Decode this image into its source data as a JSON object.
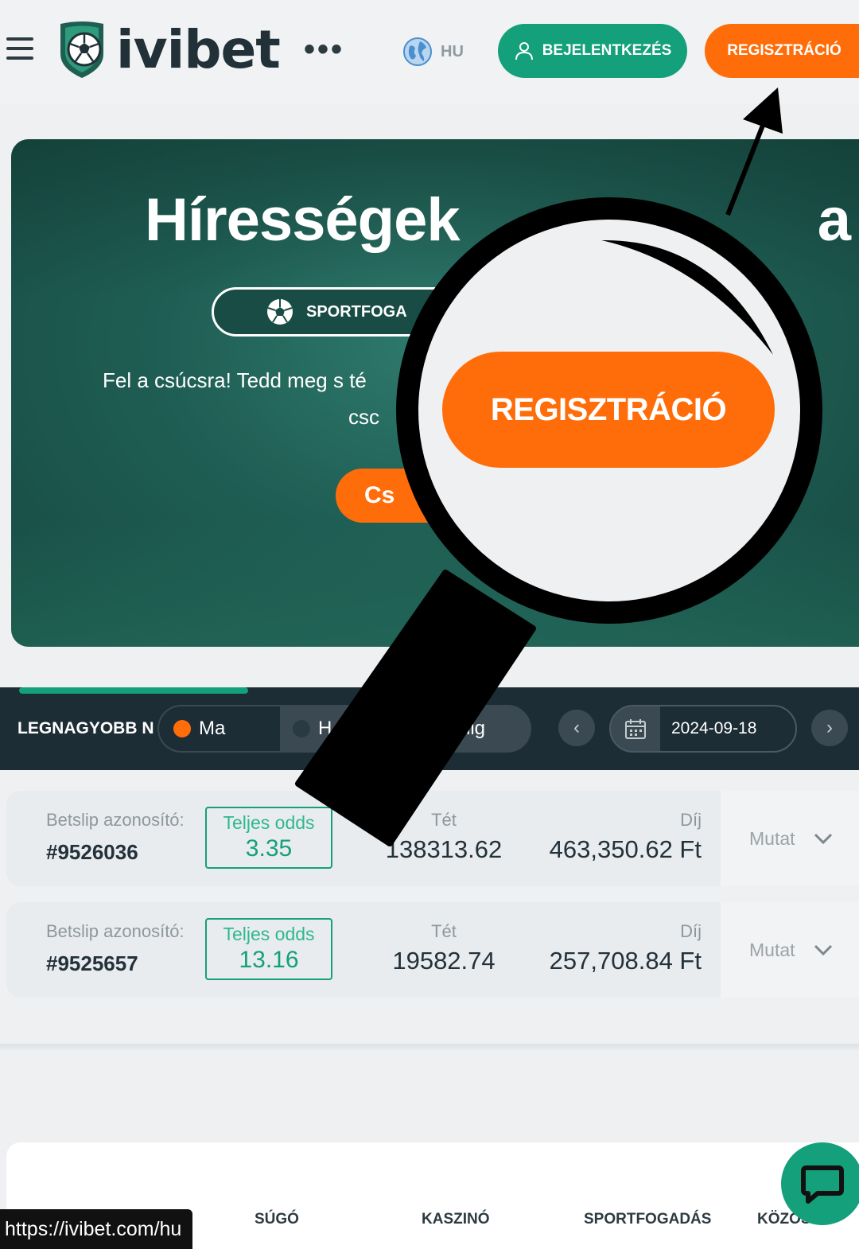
{
  "header": {
    "logo_text": "ivibet",
    "more_label": "•••",
    "language": "HU",
    "login_label": "BEJELENTKEZÉS",
    "register_label": "REGISZTRÁCIÓ"
  },
  "banner": {
    "title": "Hírességek",
    "title_right": "a",
    "pill_label": "SPORTFOGA",
    "description_line1": "Fel a csúcsra! Tedd meg s té",
    "description_line2": "csc",
    "cta_label": "Cs"
  },
  "magnifier": {
    "zoom_label": "REGISZTRÁCIÓ"
  },
  "biggest_wins": {
    "title": "LEGNAGYOBB N",
    "tabs": [
      {
        "label": "Ma",
        "active": true
      },
      {
        "label": "H"
      },
      {
        "label": "dig"
      }
    ],
    "prev_icon": "‹",
    "next_icon": "›",
    "date": "2024-09-18",
    "columns": {
      "id_label": "Betslip azonosító:",
      "odds_label": "Teljes odds",
      "stake_label": "Tét",
      "prize_label": "Díj",
      "show_label": "Mutat"
    },
    "rows": [
      {
        "id": "#9526036",
        "odds": "3.35",
        "stake": "138313.62",
        "prize": "463,350.62 Ft"
      },
      {
        "id": "#9525657",
        "odds": "13.16",
        "stake": "19582.74",
        "prize": "257,708.84 Ft"
      }
    ]
  },
  "footer": {
    "nav": [
      "SÚGÓ",
      "KASZINÓ",
      "SPORTFOGADÁS",
      "KÖZÖS"
    ],
    "url_tooltip": "https://ivibet.com/hu"
  },
  "colors": {
    "accent_green": "#13a07a",
    "accent_orange": "#ff6d0a",
    "dark_strip": "#1d2d35"
  },
  "icons": [
    "menu-icon",
    "logo-ball-icon",
    "globe-icon",
    "user-icon",
    "soccer-ball-icon",
    "calendar-icon",
    "chevron-down-icon",
    "chat-icon",
    "magnifier-icon",
    "arrow-icon"
  ]
}
